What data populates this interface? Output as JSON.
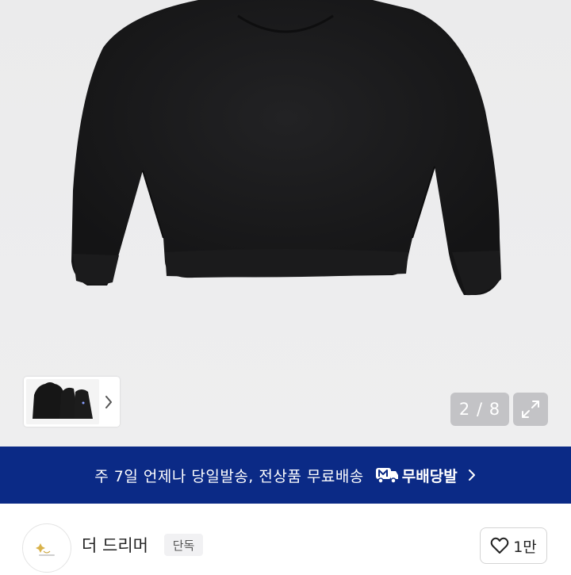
{
  "gallery": {
    "counter": "2 / 8",
    "image": "black-hoodie-back",
    "thumbnail": "black-hoodie-thumbnails",
    "next_icon": "chevron-right-icon",
    "expand_icon": "expand-icon"
  },
  "banner": {
    "text": "주 7일 언제나 당일발송, 전상품 무료배송",
    "badge_label": "무배당발",
    "badge_icon": "delivery-truck-icon",
    "background": "#0b2a86"
  },
  "seller": {
    "name": "더 드리머",
    "tag": "단독",
    "avatar_icon": "store-logo-icon",
    "like_count": "1만",
    "like_icon": "heart-icon"
  }
}
